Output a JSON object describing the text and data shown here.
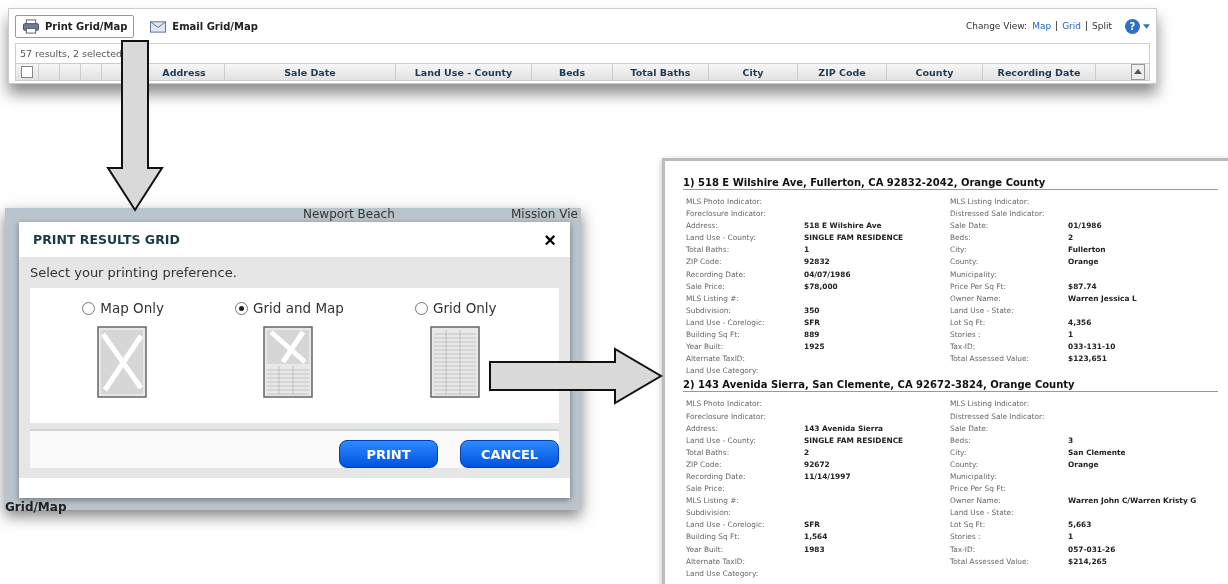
{
  "toolbar": {
    "buttons": [
      {
        "label": "Print Grid/Map",
        "kind": "print",
        "selected": true
      },
      {
        "label": "Email Grid/Map",
        "kind": "email",
        "selected": false
      }
    ],
    "change_view_label": "Change View:",
    "help": "?",
    "views": [
      {
        "label": "Map",
        "selected": false
      },
      {
        "label": "Grid",
        "selected": false
      },
      {
        "label": "Split",
        "selected": true
      }
    ]
  },
  "grid": {
    "summary": "57 results, 2 selected",
    "checked": false,
    "columns": [
      "Address",
      "Sale Date",
      "Land Use - County",
      "Beds",
      "Total Baths",
      "City",
      "ZIP Code",
      "County",
      "Recording Date"
    ]
  },
  "map_background": {
    "labels": [
      "Newport Beach",
      "Mission Vie"
    ],
    "footer": "Grid/Map"
  },
  "dialog": {
    "title": "PRINT RESULTS GRID",
    "close": "×",
    "prompt": "Select your printing preference.",
    "options": [
      {
        "label": "Map Only",
        "kind": "map",
        "selected": false
      },
      {
        "label": "Grid and Map",
        "kind": "both",
        "selected": true
      },
      {
        "label": "Grid Only",
        "kind": "grid",
        "selected": false
      }
    ],
    "buttons": [
      "PRINT",
      "CANCEL"
    ]
  },
  "records": [
    {
      "title": "1) 518 E Wilshire Ave, Fullerton, CA 92832-2042, Orange County",
      "left": [
        {
          "label": "MLS Photo Indicator:"
        },
        {
          "label": "Foreclosure Indicator:"
        },
        {
          "label": "Address:",
          "value": "518 E Wilshire Ave"
        },
        {
          "label": "Land Use - County:",
          "value": "SINGLE FAM RESIDENCE"
        },
        {
          "label": "Total Baths:",
          "value": "1"
        },
        {
          "label": "ZIP Code:",
          "value": "92832"
        },
        {
          "label": "Recording Date:",
          "value": "04/07/1986"
        },
        {
          "label": "Sale Price:",
          "value": "$78,000"
        },
        {
          "label": "MLS Listing #:"
        },
        {
          "label": "Subdivision:",
          "value": "350"
        },
        {
          "label": "Land Use - Corelogic:",
          "value": "SFR"
        },
        {
          "label": "Building Sq Ft:",
          "value": "889"
        },
        {
          "label": "Year Built:",
          "value": "1925"
        },
        {
          "label": "Alternate TaxID:"
        },
        {
          "label": "Land Use Category:"
        }
      ],
      "right": [
        {
          "label": "MLS Listing Indicator:"
        },
        {
          "label": "Distressed Sale Indicator:"
        },
        {
          "label": "Sale Date:",
          "value": "01/1986"
        },
        {
          "label": "Beds:",
          "value": "2"
        },
        {
          "label": "City:",
          "value": "Fullerton"
        },
        {
          "label": "County:",
          "value": "Orange"
        },
        {
          "label": "Municipality:"
        },
        {
          "label": "Price Per Sq Ft:",
          "value": "$87.74"
        },
        {
          "label": "Owner Name:",
          "value": "Warren Jessica L"
        },
        {
          "label": "Land Use - State:"
        },
        {
          "label": "Lot Sq Ft:",
          "value": "4,356"
        },
        {
          "label": "Stories :",
          "value": "1"
        },
        {
          "label": "Tax-ID:",
          "value": "033-131-10"
        },
        {
          "label": "Total Assessed Value:",
          "value": "$123,651"
        }
      ]
    },
    {
      "title": "2) 143 Avenida Sierra, San Clemente, CA 92672-3824, Orange County",
      "left": [
        {
          "label": "MLS Photo Indicator:"
        },
        {
          "label": "Foreclosure Indicator:"
        },
        {
          "label": "Address:",
          "value": "143 Avenida Sierra"
        },
        {
          "label": "Land Use - County:",
          "value": "SINGLE FAM RESIDENCE"
        },
        {
          "label": "Total Baths:",
          "value": "2"
        },
        {
          "label": "ZIP Code:",
          "value": "92672"
        },
        {
          "label": "Recording Date:",
          "value": "11/14/1997"
        },
        {
          "label": "Sale Price:"
        },
        {
          "label": "MLS Listing #:"
        },
        {
          "label": "Subdivision:"
        },
        {
          "label": "Land Use - Corelogic:",
          "value": "SFR"
        },
        {
          "label": "Building Sq Ft:",
          "value": "1,564"
        },
        {
          "label": "Year Built:",
          "value": "1983"
        },
        {
          "label": "Alternate TaxID:"
        },
        {
          "label": "Land Use Category:"
        }
      ],
      "right": [
        {
          "label": "MLS Listing Indicator:"
        },
        {
          "label": "Distressed Sale Indicator:"
        },
        {
          "label": "Sale Date:"
        },
        {
          "label": "Beds:",
          "value": "3"
        },
        {
          "label": "City:",
          "value": "San Clemente"
        },
        {
          "label": "County:",
          "value": "Orange"
        },
        {
          "label": "Municipality:"
        },
        {
          "label": "Price Per Sq Ft:"
        },
        {
          "label": "Owner Name:",
          "value": "Warren John C/Warren Kristy G"
        },
        {
          "label": "Land Use - State:"
        },
        {
          "label": "Lot Sq Ft:",
          "value": "5,663"
        },
        {
          "label": "Stories :",
          "value": "1"
        },
        {
          "label": "Tax-ID:",
          "value": "057-031-26"
        },
        {
          "label": "Total Assessed Value:",
          "value": "$214,265"
        }
      ]
    }
  ]
}
